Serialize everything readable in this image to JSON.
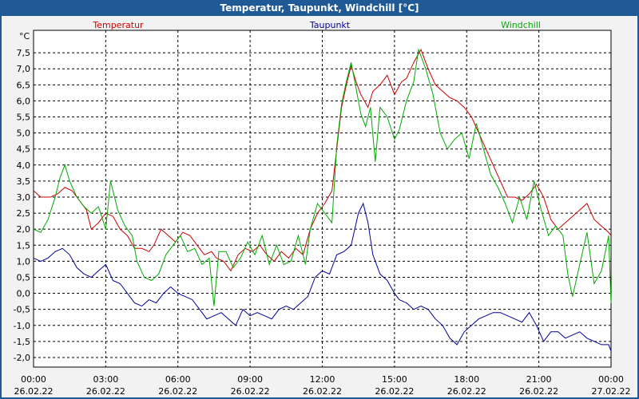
{
  "window": {
    "title": "Temperatur, Taupunkt, Windchill [°C]"
  },
  "chart_data": {
    "type": "line",
    "title": "Temperatur, Taupunkt, Windchill [°C]",
    "ylabel": "°C",
    "ylim": [
      -2.3,
      8.2
    ],
    "xlim": [
      0,
      24
    ],
    "grid": true,
    "legend_placement": "top",
    "yticks": [
      "7,5",
      "7,0",
      "6,5",
      "6,0",
      "5,5",
      "5,0",
      "4,5",
      "4,0",
      "3,5",
      "3,0",
      "2,5",
      "2,0",
      "1,5",
      "1,0",
      "0,5",
      "0,0",
      "-0,5",
      "-1,0",
      "-1,5",
      "-2,0"
    ],
    "ytick_values": [
      7.5,
      7.0,
      6.5,
      6.0,
      5.5,
      5.0,
      4.5,
      4.0,
      3.5,
      3.0,
      2.5,
      2.0,
      1.5,
      1.0,
      0.5,
      0.0,
      -0.5,
      -1.0,
      -1.5,
      -2.0
    ],
    "xticks": [
      {
        "time": "00:00",
        "date": "26.02.22"
      },
      {
        "time": "03:00",
        "date": "26.02.22"
      },
      {
        "time": "06:00",
        "date": "26.02.22"
      },
      {
        "time": "09:00",
        "date": "26.02.22"
      },
      {
        "time": "12:00",
        "date": "26.02.22"
      },
      {
        "time": "15:00",
        "date": "26.02.22"
      },
      {
        "time": "18:00",
        "date": "26.02.22"
      },
      {
        "time": "21:00",
        "date": "26.02.22"
      },
      {
        "time": "00:00",
        "date": "27.02.22"
      }
    ],
    "series": [
      {
        "name": "Temperatur",
        "color": "#cc0000",
        "points": [
          [
            0,
            3.2
          ],
          [
            0.3,
            3.0
          ],
          [
            0.7,
            3.0
          ],
          [
            1.0,
            3.1
          ],
          [
            1.3,
            3.3
          ],
          [
            1.6,
            3.2
          ],
          [
            1.9,
            2.9
          ],
          [
            2.2,
            2.6
          ],
          [
            2.4,
            2.0
          ],
          [
            2.7,
            2.2
          ],
          [
            3.0,
            2.5
          ],
          [
            3.3,
            2.4
          ],
          [
            3.6,
            2.0
          ],
          [
            3.9,
            1.8
          ],
          [
            4.2,
            1.4
          ],
          [
            4.5,
            1.4
          ],
          [
            4.8,
            1.3
          ],
          [
            5.0,
            1.5
          ],
          [
            5.3,
            2.0
          ],
          [
            5.6,
            1.8
          ],
          [
            5.9,
            1.6
          ],
          [
            6.2,
            1.9
          ],
          [
            6.5,
            1.8
          ],
          [
            6.8,
            1.5
          ],
          [
            7.1,
            1.2
          ],
          [
            7.4,
            1.3
          ],
          [
            7.6,
            1.1
          ],
          [
            7.9,
            1.0
          ],
          [
            8.2,
            0.7
          ],
          [
            8.5,
            1.2
          ],
          [
            8.8,
            1.4
          ],
          [
            9.1,
            1.3
          ],
          [
            9.4,
            1.5
          ],
          [
            9.7,
            1.2
          ],
          [
            10.0,
            1.0
          ],
          [
            10.3,
            1.3
          ],
          [
            10.6,
            1.1
          ],
          [
            10.9,
            1.4
          ],
          [
            11.2,
            1.2
          ],
          [
            11.5,
            2.0
          ],
          [
            11.8,
            2.5
          ],
          [
            12.1,
            2.8
          ],
          [
            12.4,
            3.2
          ],
          [
            12.6,
            4.5
          ],
          [
            12.8,
            5.8
          ],
          [
            13.0,
            6.5
          ],
          [
            13.2,
            7.1
          ],
          [
            13.4,
            6.6
          ],
          [
            13.6,
            6.2
          ],
          [
            13.9,
            5.8
          ],
          [
            14.1,
            6.3
          ],
          [
            14.4,
            6.5
          ],
          [
            14.7,
            6.8
          ],
          [
            15.0,
            6.2
          ],
          [
            15.3,
            6.6
          ],
          [
            15.5,
            6.7
          ],
          [
            15.8,
            7.2
          ],
          [
            16.1,
            7.6
          ],
          [
            16.4,
            7.0
          ],
          [
            16.7,
            6.5
          ],
          [
            17.0,
            6.3
          ],
          [
            17.3,
            6.1
          ],
          [
            17.6,
            6.0
          ],
          [
            17.9,
            5.8
          ],
          [
            18.2,
            5.5
          ],
          [
            18.5,
            5.0
          ],
          [
            18.8,
            4.5
          ],
          [
            19.1,
            4.0
          ],
          [
            19.4,
            3.5
          ],
          [
            19.7,
            3.0
          ],
          [
            20.0,
            3.0
          ],
          [
            20.3,
            2.9
          ],
          [
            20.6,
            3.1
          ],
          [
            20.9,
            3.4
          ],
          [
            21.2,
            3.0
          ],
          [
            21.5,
            2.3
          ],
          [
            21.8,
            2.0
          ],
          [
            22.1,
            2.2
          ],
          [
            22.4,
            2.4
          ],
          [
            22.7,
            2.6
          ],
          [
            23.0,
            2.8
          ],
          [
            23.3,
            2.3
          ],
          [
            23.6,
            2.1
          ],
          [
            23.9,
            1.9
          ],
          [
            24.0,
            1.8
          ]
        ]
      },
      {
        "name": "Taupunkt",
        "color": "#000099",
        "points": [
          [
            0,
            1.1
          ],
          [
            0.3,
            1.0
          ],
          [
            0.6,
            1.1
          ],
          [
            0.9,
            1.3
          ],
          [
            1.2,
            1.4
          ],
          [
            1.5,
            1.2
          ],
          [
            1.8,
            0.8
          ],
          [
            2.1,
            0.6
          ],
          [
            2.4,
            0.5
          ],
          [
            2.7,
            0.7
          ],
          [
            3.0,
            0.9
          ],
          [
            3.3,
            0.4
          ],
          [
            3.6,
            0.3
          ],
          [
            3.9,
            0.0
          ],
          [
            4.2,
            -0.3
          ],
          [
            4.5,
            -0.4
          ],
          [
            4.8,
            -0.2
          ],
          [
            5.1,
            -0.3
          ],
          [
            5.4,
            0.0
          ],
          [
            5.7,
            0.2
          ],
          [
            6.0,
            0.0
          ],
          [
            6.3,
            -0.1
          ],
          [
            6.6,
            -0.2
          ],
          [
            6.9,
            -0.5
          ],
          [
            7.2,
            -0.8
          ],
          [
            7.5,
            -0.7
          ],
          [
            7.8,
            -0.6
          ],
          [
            8.1,
            -0.8
          ],
          [
            8.4,
            -1.0
          ],
          [
            8.7,
            -0.5
          ],
          [
            9.0,
            -0.7
          ],
          [
            9.3,
            -0.6
          ],
          [
            9.6,
            -0.7
          ],
          [
            9.9,
            -0.8
          ],
          [
            10.2,
            -0.5
          ],
          [
            10.5,
            -0.4
          ],
          [
            10.8,
            -0.5
          ],
          [
            11.1,
            -0.3
          ],
          [
            11.4,
            -0.1
          ],
          [
            11.7,
            0.5
          ],
          [
            12.0,
            0.7
          ],
          [
            12.3,
            0.6
          ],
          [
            12.6,
            1.2
          ],
          [
            12.9,
            1.3
          ],
          [
            13.2,
            1.5
          ],
          [
            13.5,
            2.5
          ],
          [
            13.7,
            2.8
          ],
          [
            13.9,
            2.2
          ],
          [
            14.1,
            1.2
          ],
          [
            14.4,
            0.6
          ],
          [
            14.7,
            0.4
          ],
          [
            15.0,
            0.0
          ],
          [
            15.2,
            -0.2
          ],
          [
            15.5,
            -0.3
          ],
          [
            15.8,
            -0.5
          ],
          [
            16.1,
            -0.4
          ],
          [
            16.4,
            -0.5
          ],
          [
            16.7,
            -0.8
          ],
          [
            17.0,
            -1.0
          ],
          [
            17.3,
            -1.4
          ],
          [
            17.6,
            -1.6
          ],
          [
            17.9,
            -1.2
          ],
          [
            18.2,
            -1.0
          ],
          [
            18.5,
            -0.8
          ],
          [
            18.8,
            -0.7
          ],
          [
            19.1,
            -0.6
          ],
          [
            19.4,
            -0.6
          ],
          [
            19.7,
            -0.7
          ],
          [
            20.0,
            -0.8
          ],
          [
            20.3,
            -0.9
          ],
          [
            20.6,
            -0.6
          ],
          [
            20.9,
            -1.0
          ],
          [
            21.2,
            -1.5
          ],
          [
            21.5,
            -1.2
          ],
          [
            21.8,
            -1.2
          ],
          [
            22.1,
            -1.4
          ],
          [
            22.4,
            -1.3
          ],
          [
            22.7,
            -1.2
          ],
          [
            23.0,
            -1.4
          ],
          [
            23.3,
            -1.5
          ],
          [
            23.6,
            -1.6
          ],
          [
            23.9,
            -1.6
          ],
          [
            24.0,
            -1.8
          ]
        ]
      },
      {
        "name": "Windchill",
        "color": "#00aa00",
        "points": [
          [
            0,
            2.0
          ],
          [
            0.3,
            1.9
          ],
          [
            0.6,
            2.3
          ],
          [
            0.9,
            3.0
          ],
          [
            1.1,
            3.6
          ],
          [
            1.3,
            4.0
          ],
          [
            1.5,
            3.5
          ],
          [
            1.8,
            3.0
          ],
          [
            2.1,
            2.7
          ],
          [
            2.4,
            2.5
          ],
          [
            2.7,
            2.7
          ],
          [
            3.0,
            2.0
          ],
          [
            3.2,
            3.5
          ],
          [
            3.5,
            2.6
          ],
          [
            3.8,
            2.1
          ],
          [
            4.1,
            1.8
          ],
          [
            4.3,
            1.0
          ],
          [
            4.6,
            0.5
          ],
          [
            4.9,
            0.4
          ],
          [
            5.2,
            0.6
          ],
          [
            5.5,
            1.2
          ],
          [
            5.8,
            1.5
          ],
          [
            6.1,
            1.8
          ],
          [
            6.4,
            1.3
          ],
          [
            6.7,
            1.4
          ],
          [
            7.0,
            0.9
          ],
          [
            7.3,
            1.1
          ],
          [
            7.5,
            -0.4
          ],
          [
            7.7,
            1.3
          ],
          [
            8.0,
            1.3
          ],
          [
            8.3,
            0.8
          ],
          [
            8.6,
            1.1
          ],
          [
            8.9,
            1.6
          ],
          [
            9.2,
            1.2
          ],
          [
            9.5,
            1.8
          ],
          [
            9.8,
            0.9
          ],
          [
            10.1,
            1.5
          ],
          [
            10.4,
            0.9
          ],
          [
            10.7,
            1.0
          ],
          [
            11.0,
            1.8
          ],
          [
            11.3,
            0.9
          ],
          [
            11.5,
            2.0
          ],
          [
            11.8,
            2.8
          ],
          [
            12.1,
            2.5
          ],
          [
            12.4,
            2.2
          ],
          [
            12.6,
            4.6
          ],
          [
            12.8,
            5.9
          ],
          [
            13.0,
            6.6
          ],
          [
            13.2,
            7.2
          ],
          [
            13.4,
            6.4
          ],
          [
            13.6,
            5.6
          ],
          [
            13.8,
            5.2
          ],
          [
            14.0,
            5.8
          ],
          [
            14.2,
            4.1
          ],
          [
            14.4,
            5.8
          ],
          [
            14.7,
            5.5
          ],
          [
            15.0,
            4.8
          ],
          [
            15.2,
            5.1
          ],
          [
            15.5,
            6.0
          ],
          [
            15.8,
            6.6
          ],
          [
            16.0,
            7.6
          ],
          [
            16.3,
            7.0
          ],
          [
            16.6,
            6.2
          ],
          [
            16.9,
            5.0
          ],
          [
            17.2,
            4.5
          ],
          [
            17.5,
            4.8
          ],
          [
            17.8,
            5.0
          ],
          [
            18.1,
            4.2
          ],
          [
            18.4,
            5.3
          ],
          [
            18.7,
            4.5
          ],
          [
            19.0,
            3.7
          ],
          [
            19.3,
            3.3
          ],
          [
            19.6,
            2.8
          ],
          [
            19.9,
            2.2
          ],
          [
            20.2,
            3.0
          ],
          [
            20.5,
            2.3
          ],
          [
            20.8,
            3.5
          ],
          [
            21.1,
            2.6
          ],
          [
            21.4,
            1.8
          ],
          [
            21.7,
            2.1
          ],
          [
            22.0,
            1.8
          ],
          [
            22.2,
            0.6
          ],
          [
            22.4,
            -0.1
          ],
          [
            22.7,
            0.9
          ],
          [
            23.0,
            1.9
          ],
          [
            23.3,
            0.3
          ],
          [
            23.6,
            0.7
          ],
          [
            23.9,
            1.8
          ],
          [
            24.0,
            -0.3
          ]
        ]
      }
    ]
  }
}
